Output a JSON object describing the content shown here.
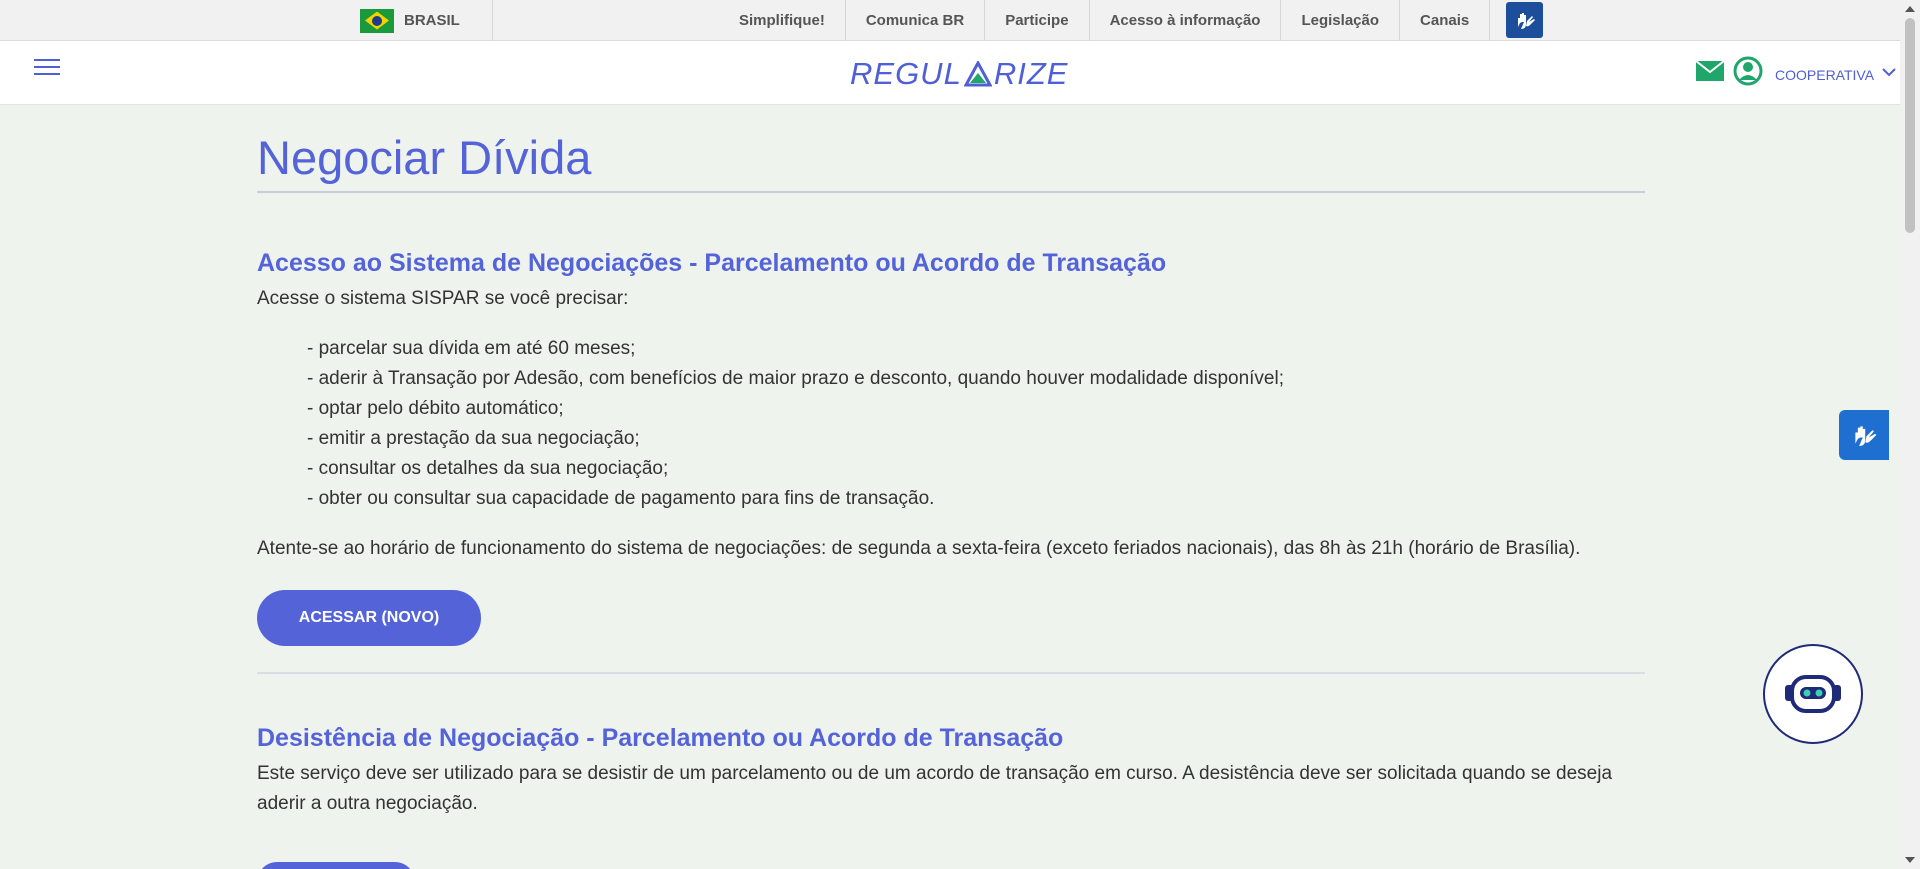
{
  "govbar": {
    "country": "BRASIL",
    "links": [
      "Simplifique!",
      "Comunica BR",
      "Participe",
      "Acesso à informação",
      "Legislação",
      "Canais"
    ]
  },
  "header": {
    "logo": {
      "left": "REGUL",
      "right": "RIZE"
    },
    "profile_label": "COOPERATIVA"
  },
  "main": {
    "page_title": "Negociar Dívida",
    "section1": {
      "title": "Acesso ao Sistema de Negociações - Parcelamento ou Acordo de Transação",
      "intro": "Acesse o sistema SISPAR se você precisar:",
      "items": [
        "- parcelar sua dívida em até 60 meses;",
        "- aderir à Transação por Adesão, com benefícios de maior prazo e desconto, quando houver modalidade disponível;",
        "- optar pelo débito automático;",
        "- emitir a prestação da sua negociação;",
        "- consultar os detalhes da sua negociação;",
        "- obter ou consultar sua capacidade de pagamento para fins de transação."
      ],
      "hours": "Atente-se ao horário de funcionamento do sistema de negociações: de segunda a sexta-feira (exceto feriados nacionais), das 8h às 21h (horário de Brasília).",
      "button": "ACESSAR (NOVO)"
    },
    "section2": {
      "title": "Desistência de Negociação - Parcelamento ou Acordo de Transação",
      "text": "Este serviço deve ser utilizado para se desistir de um parcelamento ou de um acordo de transação em curso. A desistência deve ser solicitada quando se deseja aderir a outra negociação."
    }
  },
  "colors": {
    "accent": "#5563d9",
    "background": "#eef3ee",
    "green_icons": "#1fa66a"
  },
  "icons": [
    "brazil-flag-icon",
    "hand-sign-icon",
    "hamburger-icon",
    "mail-icon",
    "user-icon",
    "chevron-down-icon",
    "chatbot-icon"
  ]
}
